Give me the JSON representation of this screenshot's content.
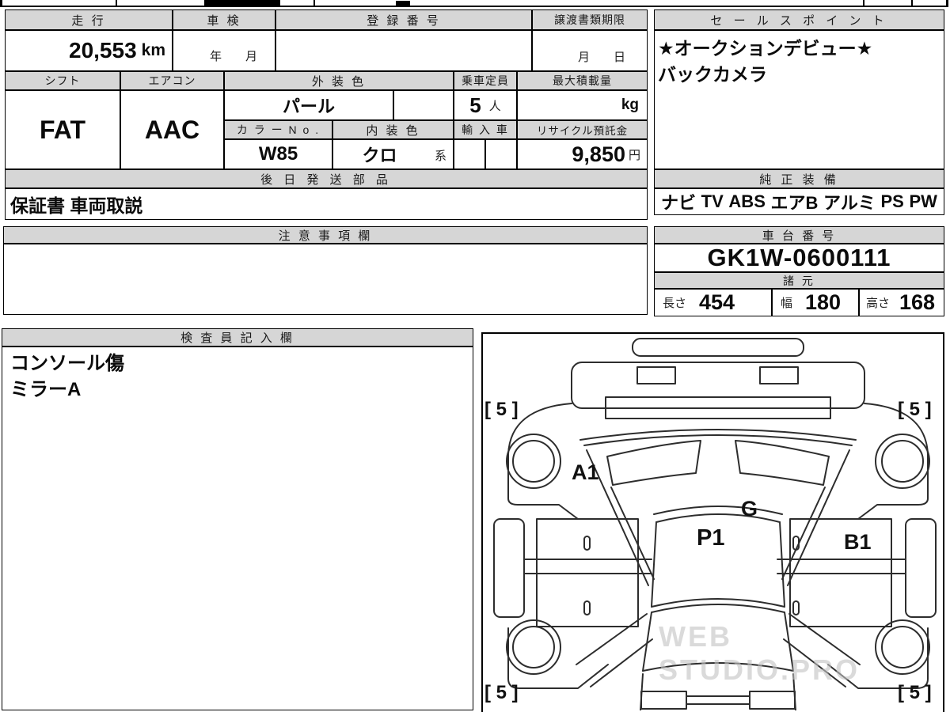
{
  "meta": {
    "watermark": "WEB STUDIO.PRO"
  },
  "vehicle": {
    "mileage": {
      "label": "走 行",
      "value": "20,553",
      "unit": "km"
    },
    "inspection": {
      "label": "車 検",
      "value": "年　　月"
    },
    "registration": {
      "label": "登 録 番 号",
      "value": ""
    },
    "transfer_deadline": {
      "label": "譲渡書類期限",
      "value": "月　　日"
    },
    "shift": {
      "label": "シフト",
      "value": "FAT"
    },
    "aircon": {
      "label": "エアコン",
      "value": "AAC"
    },
    "exterior_color": {
      "label": "外 装 色",
      "value": "パール"
    },
    "capacity": {
      "label": "乗車定員",
      "value": "5",
      "unit": "人"
    },
    "max_load": {
      "label": "最大積載量",
      "value": "",
      "unit": "kg"
    },
    "color_no": {
      "label": "カ ラ ー N o .",
      "value": "W85"
    },
    "interior_color": {
      "label": "内 装 色",
      "value": "クロ",
      "suffix": "系"
    },
    "import_car": {
      "label": "輸 入 車",
      "value": ""
    },
    "recycle_deposit": {
      "label": "リサイクル預託金",
      "value": "9,850",
      "unit": "円"
    }
  },
  "later_shipping": {
    "label": "後 日 発 送 部 品",
    "value": "保証書 車両取説"
  },
  "sales_points": {
    "label": "セ ー ル ス ポ イ ン ト",
    "lines": [
      "★オークションデビュー★",
      "バックカメラ"
    ]
  },
  "factory_equipment": {
    "label": "純 正 装 備",
    "items": [
      "ナビ",
      "TV",
      "ABS",
      "エアB",
      "アルミ",
      "PS",
      "PW"
    ]
  },
  "cautions": {
    "label": "注 意 事 項 欄",
    "value": ""
  },
  "chassis_no": {
    "label": "車 台 番 号",
    "value": "GK1W-0600111"
  },
  "dimensions": {
    "label": "諸 元",
    "length": {
      "label": "長さ",
      "value": "454"
    },
    "width": {
      "label": "幅",
      "value": "180"
    },
    "height": {
      "label": "高さ",
      "value": "168"
    }
  },
  "inspector_notes": {
    "label": "検 査 員 記 入 欄",
    "lines": [
      "コンソール傷",
      "ミラーA"
    ]
  },
  "diagram": {
    "tire_marks": {
      "front_left": "[ 5 ]",
      "front_right": "[ 5 ]",
      "rear_left": "[ 5 ]",
      "rear_right": "[ 5 ]"
    },
    "damage_marks": {
      "a1": "A1",
      "g": "G",
      "p1": "P1",
      "b1": "B1"
    }
  }
}
